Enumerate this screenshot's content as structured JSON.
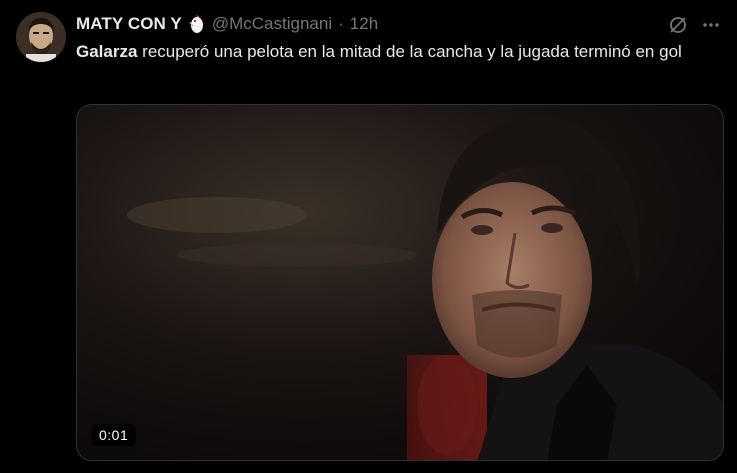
{
  "tweet": {
    "display_name": "MATY CON Y",
    "handle": "@McCastignani",
    "separator": "·",
    "time": "12h",
    "text_bold": "Galarza",
    "text_rest": " recuperó una pelota en la mitad de la cancha y la jugada terminó en gol"
  },
  "media": {
    "duration": "0:01"
  },
  "icons": {
    "grok": "grok-icon",
    "more": "more-dots-icon",
    "emoji": "chicken-emoji-icon"
  },
  "colors": {
    "background": "#000000",
    "text": "#e7e9ea",
    "muted": "#71767b",
    "border": "#2f3336"
  }
}
